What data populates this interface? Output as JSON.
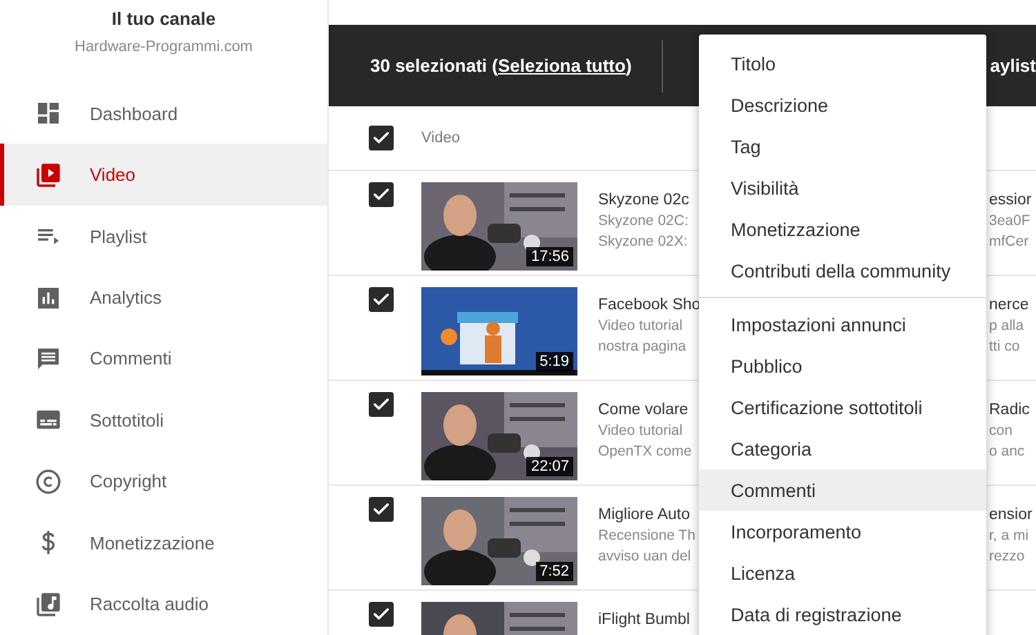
{
  "sidebar": {
    "title": "Il tuo canale",
    "subtitle": "Hardware-Programmi.com",
    "items": [
      {
        "label": "Dashboard",
        "kind": "dashboard",
        "selected": false
      },
      {
        "label": "Video",
        "kind": "video",
        "selected": true
      },
      {
        "label": "Playlist",
        "kind": "playlist",
        "selected": false
      },
      {
        "label": "Analytics",
        "kind": "analytics",
        "selected": false
      },
      {
        "label": "Commenti",
        "kind": "comments",
        "selected": false
      },
      {
        "label": "Sottotitoli",
        "kind": "subtitles",
        "selected": false
      },
      {
        "label": "Copyright",
        "kind": "copyright",
        "selected": false
      },
      {
        "label": "Monetizzazione",
        "kind": "money",
        "selected": false
      },
      {
        "label": "Raccolta audio",
        "kind": "audio",
        "selected": false
      }
    ]
  },
  "selection_bar": {
    "count": "30 selezionati (",
    "link": "Seleziona tutto",
    "close": ")",
    "right_text": "aylist"
  },
  "table": {
    "header": {
      "label": "Video",
      "checked": true
    },
    "rows": [
      {
        "checked": true,
        "duration": "17:56",
        "title": "Skyzone 02c",
        "desc": [
          "Skyzone 02C:",
          "Skyzone 02X:"
        ],
        "right": [
          "essior",
          "3ea0F",
          "mfCer"
        ]
      },
      {
        "checked": true,
        "duration": "5:19",
        "title": "Facebook Sho",
        "desc": [
          "Video tutorial",
          "nostra pagina"
        ],
        "right": [
          "nerce",
          "p alla",
          "tti co"
        ]
      },
      {
        "checked": true,
        "duration": "22:07",
        "title": "Come volare",
        "desc": [
          "Video tutorial",
          "OpenTX come"
        ],
        "right": [
          "Radic",
          "con",
          "o anc"
        ]
      },
      {
        "checked": true,
        "duration": "7:52",
        "title": "Migliore Auto",
        "desc": [
          "Recensione Th",
          "avviso uan del"
        ],
        "right": [
          "ensior",
          "r, a mi",
          "rezzo"
        ]
      },
      {
        "checked": true,
        "title": "iFlight Bumbl",
        "desc": [],
        "right": []
      }
    ]
  },
  "menu": {
    "groups": [
      [
        {
          "label": "Titolo",
          "selected": false
        },
        {
          "label": "Descrizione",
          "selected": false
        },
        {
          "label": "Tag",
          "selected": false
        },
        {
          "label": "Visibilità",
          "selected": false
        },
        {
          "label": "Monetizzazione",
          "selected": false
        },
        {
          "label": "Contributi della community",
          "selected": false
        }
      ],
      [
        {
          "label": "Impostazioni annunci",
          "selected": false
        },
        {
          "label": "Pubblico",
          "selected": false
        },
        {
          "label": "Certificazione sottotitoli",
          "selected": false
        },
        {
          "label": "Categoria",
          "selected": false
        },
        {
          "label": "Commenti",
          "selected": true
        },
        {
          "label": "Incorporamento",
          "selected": false
        },
        {
          "label": "Licenza",
          "selected": false
        },
        {
          "label": "Data di registrazione",
          "selected": false
        }
      ]
    ]
  }
}
